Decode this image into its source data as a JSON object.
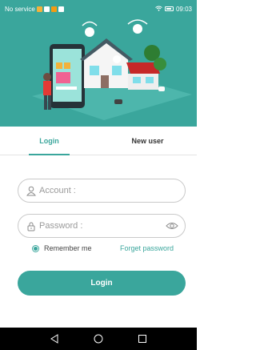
{
  "status_bar": {
    "carrier": "No service",
    "time": "09:03"
  },
  "tabs": [
    {
      "label": "Login",
      "active": true
    },
    {
      "label": "New user",
      "active": false
    }
  ],
  "form": {
    "account_placeholder": "Account :",
    "account_value": "",
    "password_placeholder": "Password :",
    "password_value": "",
    "remember_label": "Remember me",
    "remember_checked": true,
    "forget_label": "Forget password",
    "login_label": "Login"
  },
  "icons": {
    "account": "user-icon",
    "password": "lock-icon",
    "show_password": "eye-icon",
    "nav_back": "back-triangle-icon",
    "nav_home": "home-circle-icon",
    "nav_recent": "recent-square-icon"
  },
  "colors": {
    "accent": "#3aa69c",
    "navbar": "#000000"
  }
}
